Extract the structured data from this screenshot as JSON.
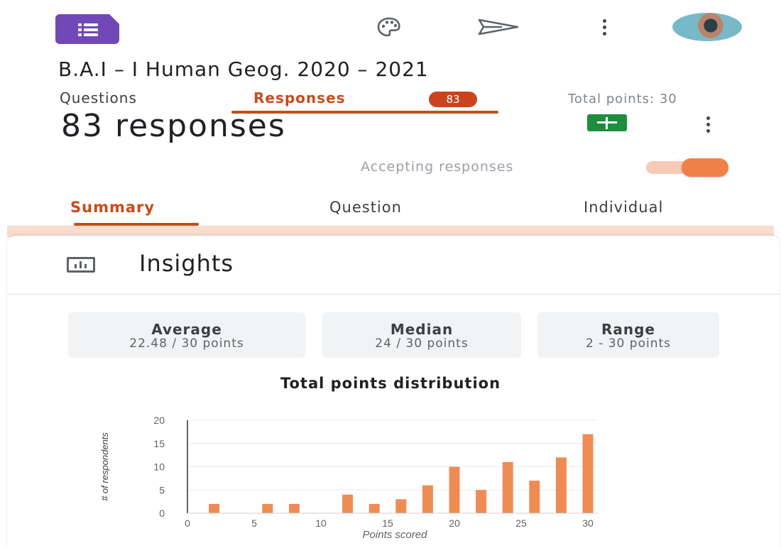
{
  "header": {
    "form_title": "B.A.I – I Human Geog. 2020 – 2021",
    "icons": [
      "forms-app-icon",
      "palette-icon",
      "send-icon",
      "more-vert-icon",
      "avatar"
    ]
  },
  "tabs": {
    "questions": "Questions",
    "responses": "Responses",
    "responses_badge": "83",
    "total_points": "Total points: 30"
  },
  "responses_panel": {
    "count_label": "83 responses",
    "accepting_label": "Accepting responses",
    "accepting_on": true,
    "subtabs": {
      "summary": "Summary",
      "question": "Question",
      "individual": "Individual"
    }
  },
  "insights": {
    "title": "Insights",
    "stats": {
      "average": {
        "label": "Average",
        "value": "22.48 / 30 points"
      },
      "median": {
        "label": "Median",
        "value": "24 / 30 points"
      },
      "range": {
        "label": "Range",
        "value": "2 - 30 points"
      }
    }
  },
  "colors": {
    "accent": "#c74c1a",
    "bar": "#ef8c54",
    "forms_purple": "#7248b9",
    "sheets_green": "#1e8e3e"
  },
  "chart_data": {
    "type": "bar",
    "title": "Total points distribution",
    "xlabel": "Points scored",
    "ylabel": "# of respondents",
    "x": [
      2,
      6,
      8,
      12,
      14,
      16,
      18,
      20,
      22,
      24,
      26,
      28,
      30
    ],
    "values": [
      2,
      2,
      2,
      4,
      2,
      3,
      6,
      10,
      5,
      11,
      7,
      12,
      17
    ],
    "xlim": [
      0,
      30
    ],
    "ylim": [
      0,
      20
    ],
    "xticks": [
      0,
      5,
      10,
      15,
      20,
      25,
      30
    ],
    "yticks": [
      0,
      5,
      10,
      15,
      20
    ],
    "grid": true
  }
}
